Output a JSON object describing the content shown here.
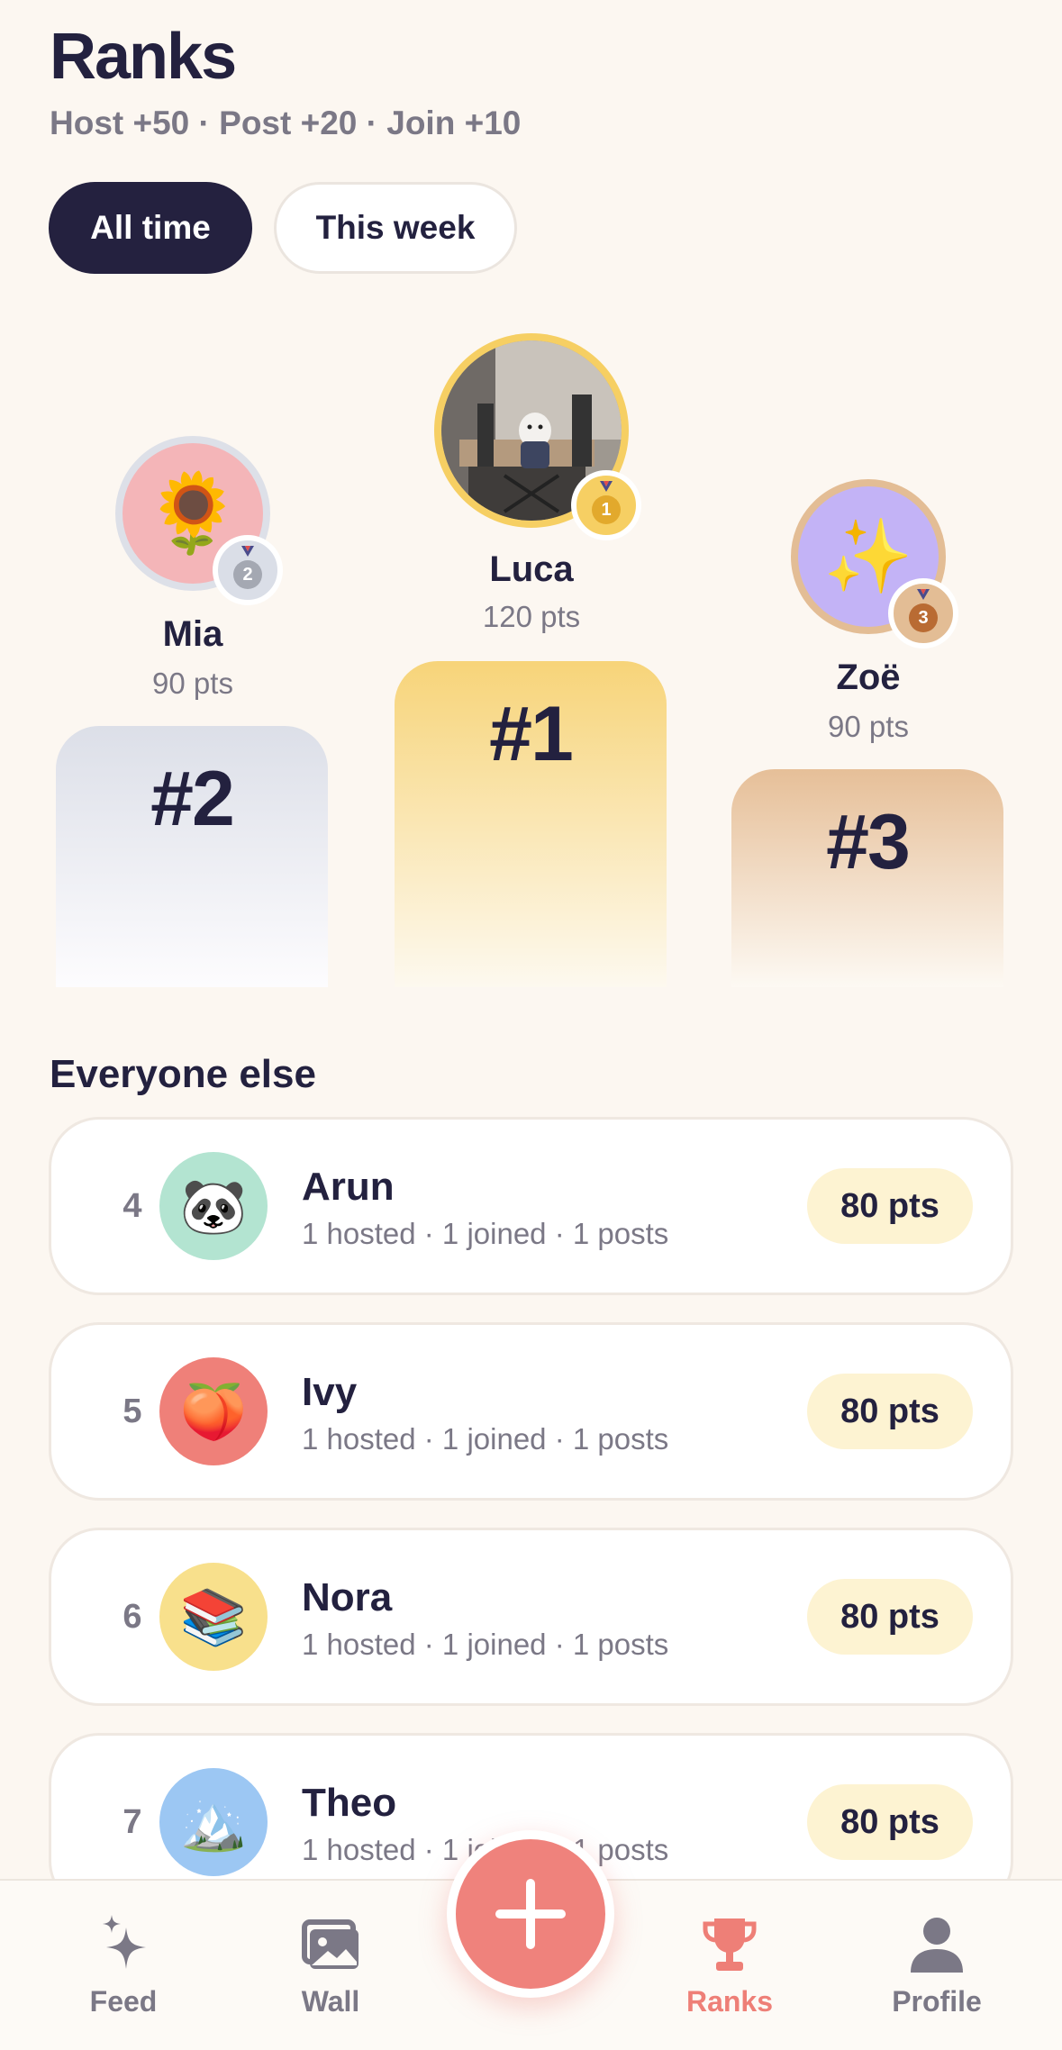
{
  "header": {
    "title": "Ranks",
    "subtitle": "Host +50 · Post +20 · Join +10"
  },
  "filters": {
    "all_time": "All time",
    "this_week": "This week",
    "selected": "All time"
  },
  "podium": {
    "first": {
      "name": "Luca",
      "points": "120 pts",
      "place_label": "#1",
      "medal_number": "1"
    },
    "second": {
      "name": "Mia",
      "points": "90 pts",
      "place_label": "#2",
      "medal_number": "2",
      "avatar_emoji": "🌻"
    },
    "third": {
      "name": "Zoë",
      "points": "90 pts",
      "place_label": "#3",
      "medal_number": "3",
      "avatar_emoji": "✨"
    }
  },
  "list": {
    "title": "Everyone else",
    "rows": [
      {
        "rank": "4",
        "name": "Arun",
        "stats": "1 hosted · 1 joined · 1 posts",
        "points": "80 pts",
        "emoji": "🐼",
        "bg": "#b3e4d1"
      },
      {
        "rank": "5",
        "name": "Ivy",
        "stats": "1 hosted · 1 joined · 1 posts",
        "points": "80 pts",
        "emoji": "🍑",
        "bg": "#ef8079"
      },
      {
        "rank": "6",
        "name": "Nora",
        "stats": "1 hosted · 1 joined · 1 posts",
        "points": "80 pts",
        "emoji": "📚",
        "bg": "#f8e08c"
      },
      {
        "rank": "7",
        "name": "Theo",
        "stats": "1 hosted · 1 joined · 1 posts",
        "points": "80 pts",
        "emoji": "🏔️",
        "bg": "#9cc7f3"
      }
    ]
  },
  "nav": {
    "feed": "Feed",
    "wall": "Wall",
    "ranks": "Ranks",
    "profile": "Profile",
    "active": "Ranks",
    "icons": [
      "sparkle-icon",
      "image-icon",
      "plus-icon",
      "trophy-icon",
      "person-icon"
    ]
  },
  "colors": {
    "background": "#fcf7f1",
    "ink": "#23213f",
    "accent": "#ef827c",
    "gold": "#f6cf63",
    "silver": "#dde0e8",
    "bronze": "#e3bd95",
    "points_pill": "#fdf3d2"
  }
}
